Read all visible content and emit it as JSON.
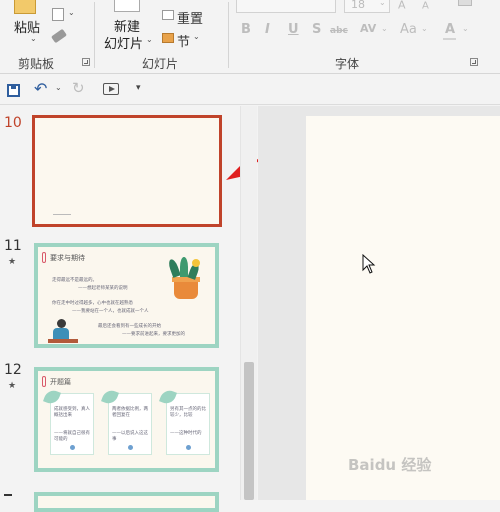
{
  "ribbon": {
    "paste_label": "粘贴",
    "clipboard_group": "剪贴板",
    "new_slide_line1": "新建",
    "new_slide_line2": "幻灯片",
    "reset_label": "重置",
    "section_label": "节",
    "slides_group": "幻灯片",
    "font_group": "字体",
    "font_size": "18",
    "format_buttons": [
      "B",
      "I",
      "U",
      "S",
      "abc",
      "AV",
      "Aa",
      "A"
    ]
  },
  "qat": {
    "icons": [
      "save-icon",
      "undo-icon",
      "redo-icon",
      "start-from-beginning-icon",
      "customize-qat-icon"
    ]
  },
  "thumbnails": [
    {
      "number": "10",
      "selected": true,
      "has_star": false
    },
    {
      "number": "11",
      "selected": false,
      "has_star": true,
      "star": "★",
      "title": "要求与期待",
      "lines": [
        "走得最远不是最远的。",
        "——想起老师某某的说明",
        "你在走中时过得越多，心中也就在越熟悉",
        "——我要站在一个人，也就成就一个人",
        "最后还会看到有一些成长的开始",
        "——要求前进起来，要求更加的"
      ]
    },
    {
      "number": "12",
      "selected": false,
      "has_star": true,
      "star": "★",
      "title": "开题篇",
      "cards": [
        [
          "成就感受到，真人概括出来",
          "——将就自己很有可能的"
        ],
        [
          "两者依据比例，两者回复在",
          "——以后说入这这事"
        ],
        [
          "另有其一点的的比较少，比较",
          "——这种时代的"
        ]
      ]
    }
  ],
  "watermark": "Baidu 经验",
  "colors": {
    "accent": "#c0432a",
    "thumb_border": "#9dd4c2",
    "arrow": "#e02020"
  }
}
